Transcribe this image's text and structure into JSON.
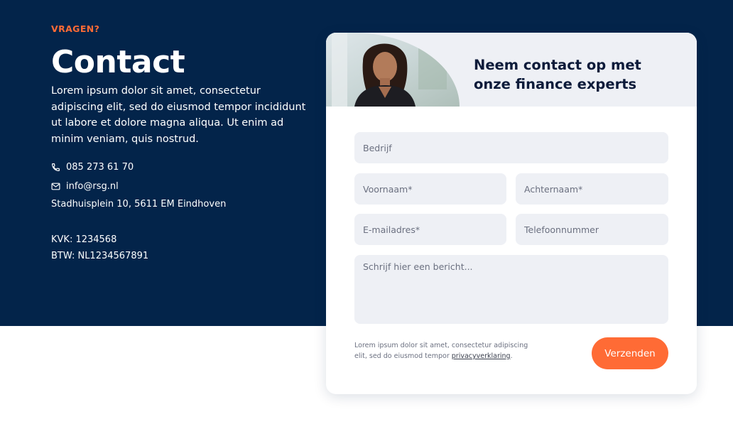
{
  "colors": {
    "navy": "#03244a",
    "accent": "#ff6b35",
    "field_bg": "#eef0f5",
    "card_title": "#0d1b3a"
  },
  "contact_section": {
    "eyebrow": "VRAGEN?",
    "title": "Contact",
    "intro": "Lorem ipsum dolor sit amet, consectetur adipiscing elit, sed do eiusmod tempor incididunt ut labore et dolore magna aliqua. Ut enim ad minim veniam, quis nostrud.",
    "phone": {
      "icon": "phone-icon",
      "text": "085 273 61 70"
    },
    "email": {
      "icon": "mail-icon",
      "text": "info@rsg.nl"
    },
    "address": "Stadhuisplein 10, 5611 EM Eindhoven",
    "kvk": "KVK: 1234568",
    "btw": "BTW: NL1234567891"
  },
  "form_card": {
    "title": "Neem contact op met onze finance experts",
    "fields": {
      "company_placeholder": "Bedrijf",
      "first_name_placeholder": "Voornaam*",
      "last_name_placeholder": "Achternaam*",
      "email_placeholder": "E-mailadres*",
      "phone_placeholder": "Telefoonnummer",
      "message_placeholder": "Schrijf hier een bericht..."
    },
    "privacy_text": "Lorem ipsum dolor sit amet, consectetur adipiscing elit, sed do eiusmod tempor ",
    "privacy_link": "privacyverklaring",
    "privacy_end": ".",
    "submit_label": "Verzenden"
  }
}
